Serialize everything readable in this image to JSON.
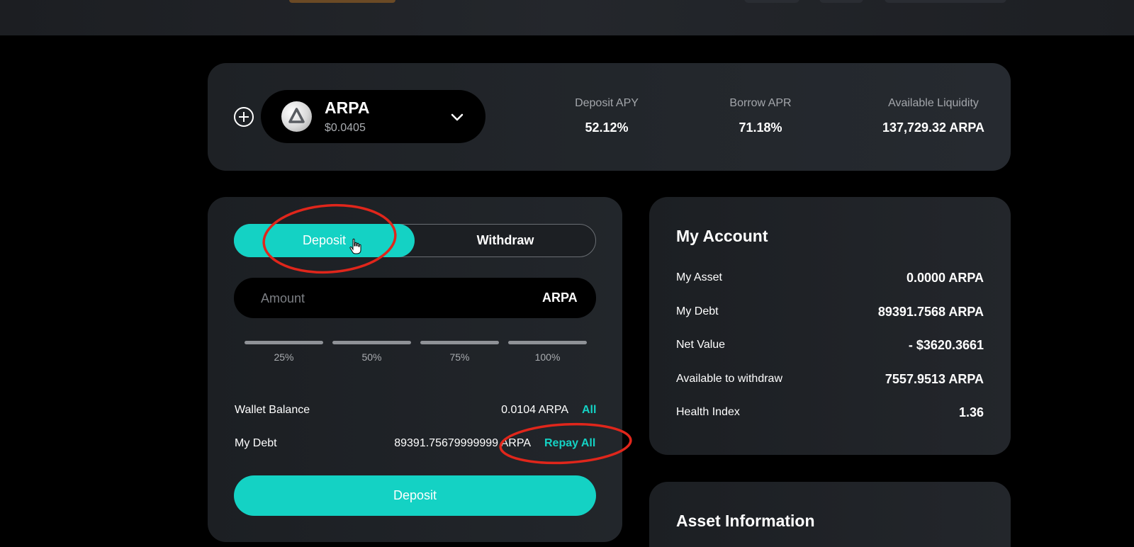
{
  "asset": {
    "symbol": "ARPA",
    "price": "$0.0405"
  },
  "stats": [
    {
      "label": "Deposit APY",
      "value": "52.12%"
    },
    {
      "label": "Borrow APR",
      "value": "71.18%"
    },
    {
      "label": "Available Liquidity",
      "value": "137,729.32 ARPA"
    }
  ],
  "tabs": {
    "deposit": "Deposit",
    "withdraw": "Withdraw"
  },
  "amount": {
    "placeholder": "Amount",
    "unit": "ARPA"
  },
  "percent_buttons": [
    "25%",
    "50%",
    "75%",
    "100%"
  ],
  "wallet": {
    "label": "Wallet Balance",
    "value": "0.0104 ARPA",
    "action": "All"
  },
  "debt": {
    "label": "My Debt",
    "value": "89391.75679999999 ARPA",
    "action": "Repay All"
  },
  "submit_label": "Deposit",
  "account": {
    "title": "My Account",
    "rows": [
      {
        "label": "My Asset",
        "value": "0.0000 ARPA"
      },
      {
        "label": "My Debt",
        "value": "89391.7568 ARPA"
      },
      {
        "label": "Net Value",
        "value": "- $3620.3661"
      },
      {
        "label": "Available to withdraw",
        "value": "7557.9513 ARPA"
      },
      {
        "label": "Health Index",
        "value": "1.36"
      }
    ]
  },
  "asset_info": {
    "title": "Asset Information"
  },
  "colors": {
    "accent": "#14d2c4",
    "annotation": "#e0261b",
    "background": "#000000"
  }
}
